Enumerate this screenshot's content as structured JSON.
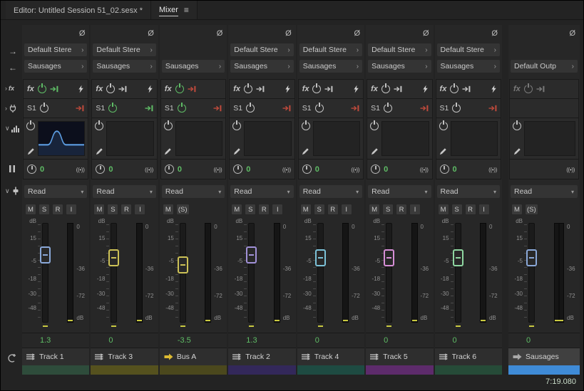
{
  "tabs": {
    "editor": "Editor: Untitled Session 51_02.sesx *",
    "mixer": "Mixer"
  },
  "icons": {
    "phase": "Ø",
    "chevron_right": "›",
    "chevron_down": "▾",
    "panel_menu": "≡",
    "arrow_right": "→",
    "arrow_left": "←",
    "stereo_field": "((•))",
    "fx_small": "fx",
    "rail_chevron_right": "›",
    "rail_chevron_down": "∨"
  },
  "scales": {
    "left": [
      "dB",
      "15",
      "-5",
      "-18",
      "-30",
      "-48"
    ],
    "right": [
      "0",
      "-36",
      "-72",
      "dB"
    ]
  },
  "channels": [
    {
      "name": "Track 1",
      "type": "track",
      "input": "Default Stere",
      "output": "Sausages",
      "fx_label": "fx",
      "fx_power": true,
      "fx_route": "green",
      "fx_lightning": true,
      "send_label": "S1",
      "send_power": false,
      "send_route": "red",
      "eq_curve": true,
      "pan": "0",
      "automation": "Read",
      "buttons": [
        "M",
        "S",
        "R",
        "I"
      ],
      "volume": "1.3",
      "fader_color": "#8aa8d8",
      "strip_color": "#2e4c3b"
    },
    {
      "name": "Track 3",
      "type": "track",
      "input": "Default Stere",
      "output": "Sausages",
      "fx_label": "fx",
      "fx_power": false,
      "fx_route": "gray",
      "fx_lightning": true,
      "send_label": "S1",
      "send_power": true,
      "send_route": "green",
      "eq_curve": false,
      "pan": "0",
      "automation": "Read",
      "buttons": [
        "M",
        "S",
        "R",
        "I"
      ],
      "volume": "0",
      "fader_color": "#ccc156",
      "strip_color": "#55511e"
    },
    {
      "name": "Bus A",
      "type": "bus",
      "input": null,
      "output": "Sausages",
      "fx_label": "fx",
      "fx_power": true,
      "fx_route": "red",
      "fx_lightning": false,
      "send_label": "S1",
      "send_power": true,
      "send_route": "red",
      "eq_curve": false,
      "pan": "0",
      "automation": "Read",
      "buttons": [
        "M",
        "(S)"
      ],
      "volume": "-3.5",
      "fader_color": "#ccc156",
      "strip_color": "#4b481d"
    },
    {
      "name": "Track 2",
      "type": "track",
      "input": "Default Stere",
      "output": "Sausages",
      "fx_label": "fx",
      "fx_power": false,
      "fx_route": "gray",
      "fx_lightning": true,
      "send_label": "S1",
      "send_power": false,
      "send_route": "red",
      "eq_curve": false,
      "pan": "0",
      "automation": "Read",
      "buttons": [
        "M",
        "S",
        "R",
        "I"
      ],
      "volume": "1.3",
      "fader_color": "#a191d8",
      "strip_color": "#33285a"
    },
    {
      "name": "Track 4",
      "type": "track",
      "input": "Default Stere",
      "output": "Sausages",
      "fx_label": "fx",
      "fx_power": false,
      "fx_route": "gray",
      "fx_lightning": true,
      "send_label": "S1",
      "send_power": false,
      "send_route": "red",
      "eq_curve": false,
      "pan": "0",
      "automation": "Read",
      "buttons": [
        "M",
        "S",
        "R",
        "I"
      ],
      "volume": "0",
      "fader_color": "#7cc2d8",
      "strip_color": "#1e4b42"
    },
    {
      "name": "Track 5",
      "type": "track",
      "input": "Default Stere",
      "output": "Sausages",
      "fx_label": "fx",
      "fx_power": false,
      "fx_route": "gray",
      "fx_lightning": true,
      "send_label": "S1",
      "send_power": false,
      "send_route": "red",
      "eq_curve": false,
      "pan": "0",
      "automation": "Read",
      "buttons": [
        "M",
        "S",
        "R",
        "I"
      ],
      "volume": "0",
      "fader_color": "#d78fd7",
      "strip_color": "#5d2b6b"
    },
    {
      "name": "Track 6",
      "type": "track",
      "input": "Default Stere",
      "output": "Sausages",
      "fx_label": "fx",
      "fx_power": false,
      "fx_route": "gray",
      "fx_lightning": true,
      "send_label": "S1",
      "send_power": false,
      "send_route": "red",
      "eq_curve": false,
      "pan": "0",
      "automation": "Read",
      "buttons": [
        "M",
        "S",
        "R",
        "I"
      ],
      "volume": "0",
      "fader_color": "#8fd7a1",
      "strip_color": "#264b38"
    },
    {
      "name": "Sausages",
      "type": "master",
      "input": null,
      "output": "Default Outp",
      "fx_label": "fx",
      "fx_power": false,
      "fx_route": "gray",
      "fx_lightning": false,
      "fx_dim": true,
      "send_label": null,
      "send_power": false,
      "send_route": "gray",
      "eq_curve": false,
      "pan": null,
      "automation": "Read",
      "buttons": [
        "M",
        "(S)"
      ],
      "volume": "0",
      "fader_color": "#8aa8d8",
      "strip_color": "#3f8bd7",
      "time": "7:19.080"
    }
  ]
}
